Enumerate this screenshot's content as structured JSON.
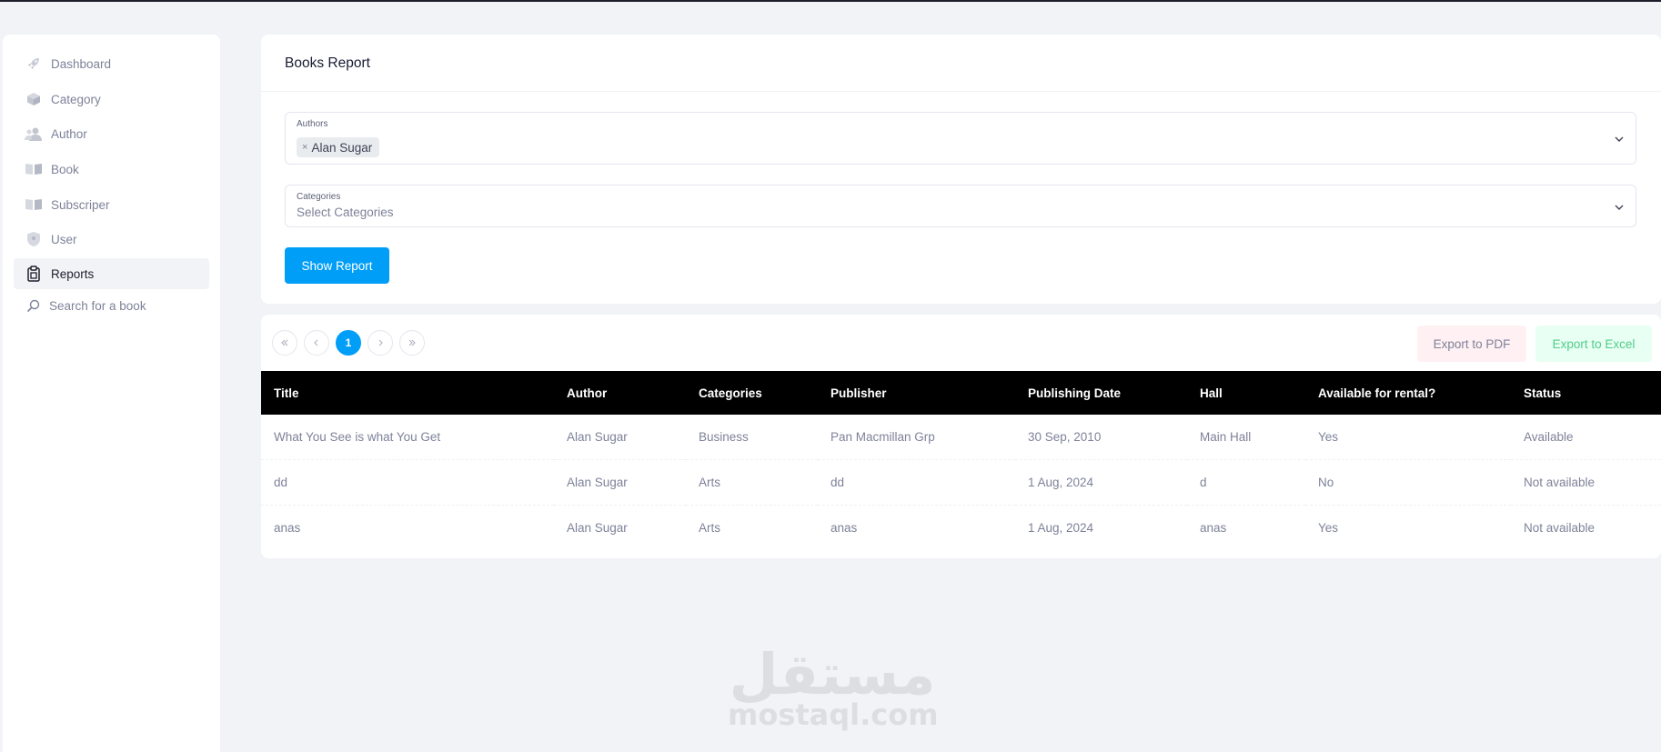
{
  "sidebar": {
    "items": [
      {
        "label": "Dashboard",
        "icon": "rocket-icon"
      },
      {
        "label": "Category",
        "icon": "box-icon"
      },
      {
        "label": "Author",
        "icon": "users-icon"
      },
      {
        "label": "Book",
        "icon": "book-icon"
      },
      {
        "label": "Subscriper",
        "icon": "book-open-icon"
      },
      {
        "label": "User",
        "icon": "shield-icon"
      },
      {
        "label": "Reports",
        "icon": "clipboard-icon",
        "active": true
      },
      {
        "label": "Search for a book",
        "icon": "search-icon"
      }
    ]
  },
  "report": {
    "title": "Books Report",
    "authors_label": "Authors",
    "selected_author": "Alan Sugar",
    "categories_label": "Categories",
    "categories_placeholder": "Select Categories",
    "show_button": "Show Report"
  },
  "pagination": {
    "current_page": "1"
  },
  "export": {
    "pdf_label": "Export to PDF",
    "excel_label": "Export to Excel"
  },
  "table": {
    "headers": [
      "Title",
      "Author",
      "Categories",
      "Publisher",
      "Publishing Date",
      "Hall",
      "Available for rental?",
      "Status"
    ],
    "rows": [
      [
        "What You See is what You Get",
        "Alan Sugar",
        "Business",
        "Pan Macmillan Grp",
        "30 Sep, 2010",
        "Main Hall",
        "Yes",
        "Available"
      ],
      [
        "dd",
        "Alan Sugar",
        "Arts",
        "dd",
        "1 Aug, 2024",
        "d",
        "No",
        "Not available"
      ],
      [
        "anas",
        "Alan Sugar",
        "Arts",
        "anas",
        "1 Aug, 2024",
        "anas",
        "Yes",
        "Not available"
      ]
    ]
  },
  "watermark": {
    "arabic": "مستقل",
    "latin": "mostaql.com"
  },
  "colors": {
    "primary": "#009ef7",
    "header_bg": "#000000",
    "page_bg": "#f1f3f6"
  }
}
